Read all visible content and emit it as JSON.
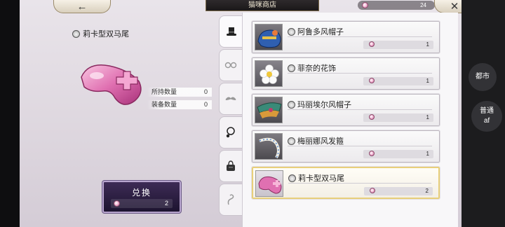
{
  "header": {
    "back_icon": "arrow-left-icon",
    "title": "猫咪商店",
    "currency_amount": "24",
    "currency_icon": "pink-coin-icon",
    "close_icon": "close-x-icon"
  },
  "selected_item": {
    "name": "莉卡型双马尾",
    "owned_label": "所持数量",
    "owned_value": "0",
    "equipped_label": "装备数量",
    "equipped_value": "0",
    "exchange_label": "兑换",
    "price": "2"
  },
  "tabs": [
    {
      "icon": "top-hat-icon",
      "active": true
    },
    {
      "icon": "glasses-icon",
      "active": false
    },
    {
      "icon": "mustache-icon",
      "active": false
    },
    {
      "icon": "necklace-icon",
      "active": false
    },
    {
      "icon": "bag-icon",
      "active": false
    },
    {
      "icon": "tail-icon",
      "active": false
    }
  ],
  "items": [
    {
      "name": "阿鲁多风帽子",
      "price": "1",
      "selected": false
    },
    {
      "name": "菲奈的花饰",
      "price": "1",
      "selected": false
    },
    {
      "name": "玛丽埃尔风帽子",
      "price": "1",
      "selected": false
    },
    {
      "name": "梅丽娜风发箍",
      "price": "1",
      "selected": false
    },
    {
      "name": "莉卡型双马尾",
      "price": "2",
      "selected": true
    }
  ],
  "overlay": {
    "city_label": "都市",
    "normal_label": "普通",
    "af_label": "af"
  },
  "colors": {
    "accent_gold": "#e8cf7a",
    "exchange_purple": "#3d2b55",
    "coin_pink": "#c2548b"
  }
}
